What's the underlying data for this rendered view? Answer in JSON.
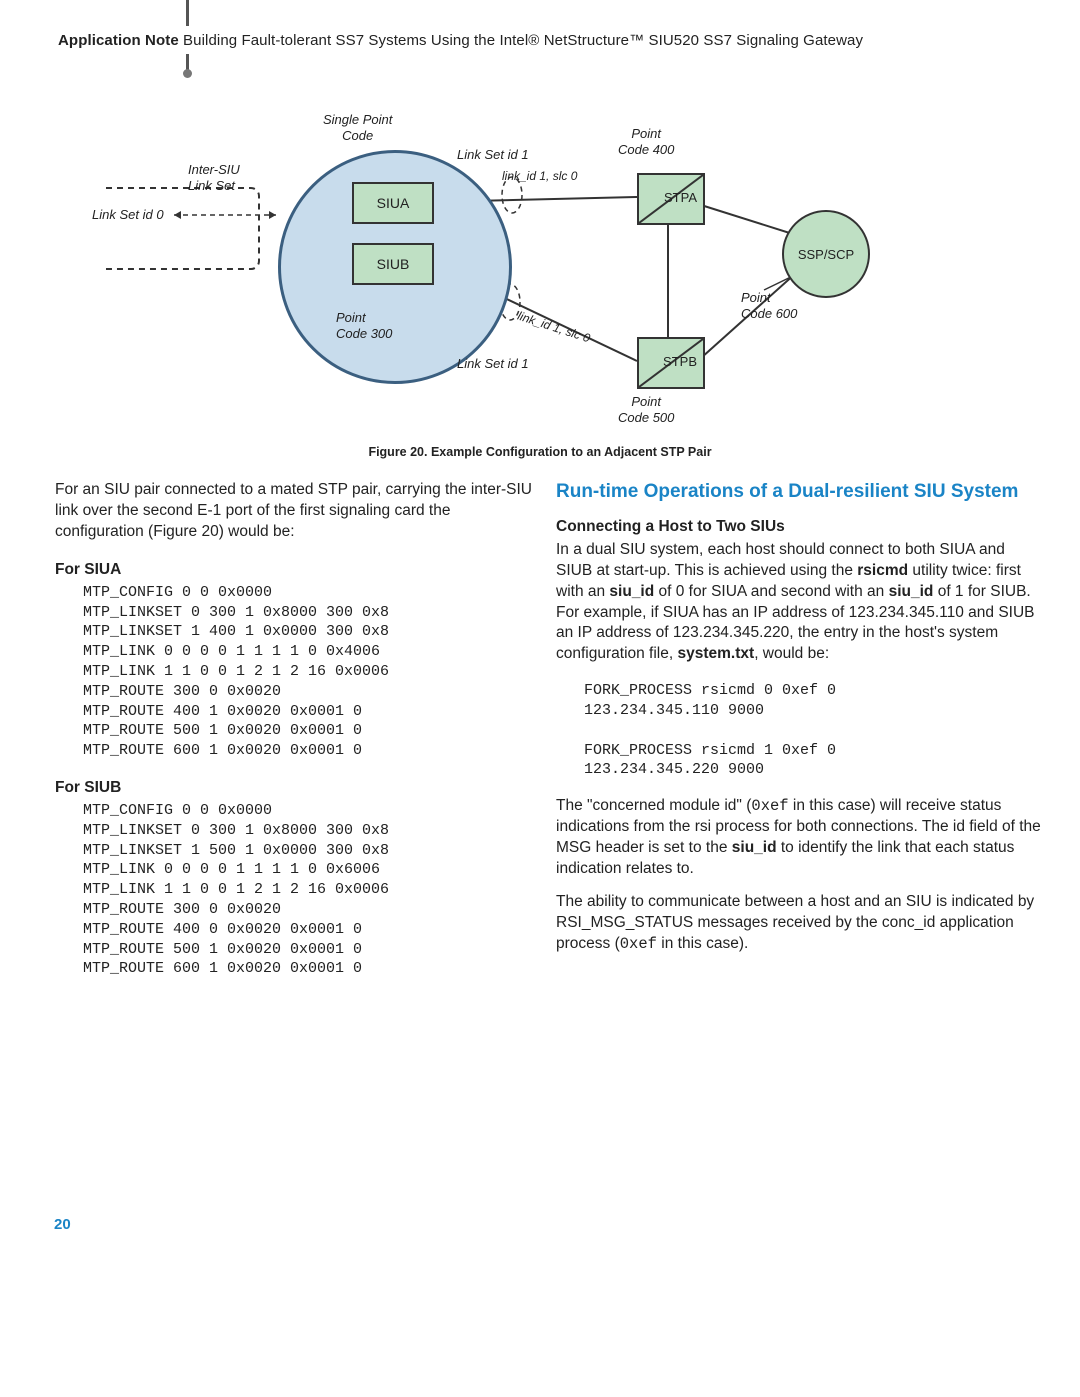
{
  "header": {
    "bold": "Application Note",
    "rest": " Building Fault-tolerant SS7 Systems Using the Intel® NetStructure™ SIU520 SS7 Signaling Gateway"
  },
  "diagram": {
    "labels": {
      "single_point": "Single Point\nCode",
      "inter_siu": "Inter-SIU\nLink Set",
      "linkset0": "Link Set id 0",
      "linkset1_top": "Link Set id 1",
      "linkset1_bot": "Link Set id 1",
      "linkid1_top": "link_id 1, slc 0",
      "linkid1_bot": "link_id 1, slc 0",
      "point300": "Point\nCode 300",
      "point400": "Point\nCode 400",
      "point500": "Point\nCode 500",
      "point600": "Point\nCode 600",
      "siua": "SIUA",
      "siub": "SIUB",
      "stpa": "STPA",
      "stpb": "STPB",
      "ssp": "SSP/SCP"
    }
  },
  "figure_caption": "Figure 20. Example Configuration to an Adjacent STP Pair",
  "left": {
    "intro": "For an SIU pair connected to a mated STP pair, carrying the inter-SIU link over the second E-1 port of the first signaling card the configuration (Figure 20) would be:",
    "siua_head": "For SIUA",
    "siua_code": "MTP_CONFIG 0 0 0x0000\nMTP_LINKSET 0 300 1 0x8000 300 0x8\nMTP_LINKSET 1 400 1 0x0000 300 0x8\nMTP_LINK 0 0 0 0 1 1 1 1 0 0x4006\nMTP_LINK 1 1 0 0 1 2 1 2 16 0x0006\nMTP_ROUTE 300 0 0x0020\nMTP_ROUTE 400 1 0x0020 0x0001 0\nMTP_ROUTE 500 1 0x0020 0x0001 0\nMTP_ROUTE 600 1 0x0020 0x0001 0",
    "siub_head": "For SIUB",
    "siub_code": "MTP_CONFIG 0 0 0x0000\nMTP_LINKSET 0 300 1 0x8000 300 0x8\nMTP_LINKSET 1 500 1 0x0000 300 0x8\nMTP_LINK 0 0 0 0 1 1 1 1 0 0x6006\nMTP_LINK 1 1 0 0 1 2 1 2 16 0x0006\nMTP_ROUTE 300 0 0x0020\nMTP_ROUTE 400 0 0x0020 0x0001 0\nMTP_ROUTE 500 1 0x0020 0x0001 0\nMTP_ROUTE 600 1 0x0020 0x0001 0"
  },
  "right": {
    "section_title": "Run-time Operations of a Dual-resilient SIU System",
    "sub1": "Connecting a Host to Two SIUs",
    "p1a": "In a dual SIU system, each host should connect to both SIUA and SIUB at start-up. This is achieved using the ",
    "p1b": "rsicmd",
    "p1c": " utility twice: first with an ",
    "p1d": "siu_id",
    "p1e": " of 0 for SIUA and second with an ",
    "p1f": "siu_id",
    "p1g": " of 1 for SIUB. For example, if SIUA has an IP address of 123.234.345.110 and SIUB an IP address of 123.234.345.220, the entry in the host's system configuration file, ",
    "p1h": "system.txt",
    "p1i": ", would be:",
    "code": "FORK_PROCESS rsicmd 0 0xef 0\n123.234.345.110 9000\n\nFORK_PROCESS rsicmd 1 0xef 0\n123.234.345.220 9000",
    "p2a": "The \"concerned module id\" (",
    "p2b": "0xef",
    "p2c": " in this case) will receive status indications from the rsi process for both connections. The id field of the MSG header is set to the ",
    "p2d": "siu_id",
    "p2e": " to identify the link that each status indication relates to.",
    "p3a": "The ability to communicate between a host and an SIU is indicated by RSI_MSG_STATUS messages received by the conc_id application process (",
    "p3b": "0xef",
    "p3c": " in this case)."
  },
  "page_number": "20"
}
